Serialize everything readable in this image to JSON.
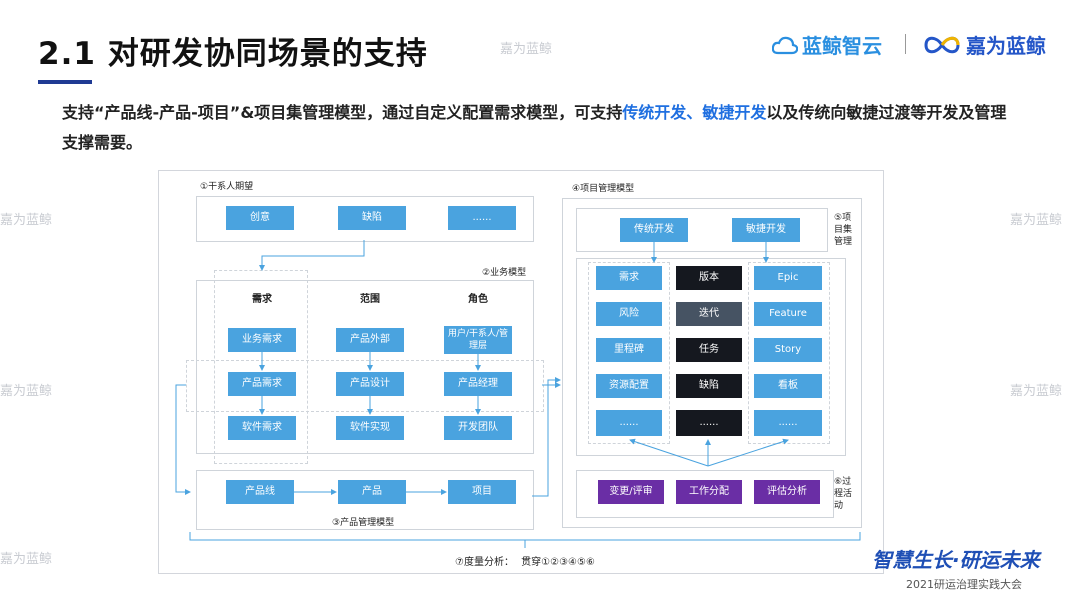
{
  "header": {
    "title": "2.1 对研发协同场景的支持",
    "logo1": "蓝鲸智云",
    "logo2": "嘉为蓝鲸",
    "watermark": "嘉为蓝鲸"
  },
  "subtitle": {
    "part1": "支持“产品线-产品-项目”&项目集管理模型，通过自定义配置需求模型，可支持",
    "hl1": "传统开发",
    "sep": "、",
    "hl2": "敏捷开发",
    "part2": "以及传统向敏捷过渡等开发及管理支撑需要。"
  },
  "diagram": {
    "stakeholder": {
      "label": "①干系人期望",
      "items": [
        "创意",
        "缺陷",
        "......"
      ]
    },
    "business": {
      "label": "②业务模型",
      "columns": [
        {
          "header": "需求",
          "items": [
            "业务需求",
            "产品需求",
            "软件需求"
          ]
        },
        {
          "header": "范围",
          "items": [
            "产品外部",
            "产品设计",
            "软件实现"
          ]
        },
        {
          "header": "角色",
          "items": [
            "用户/干系人/管理层",
            "产品经理",
            "开发团队"
          ]
        }
      ]
    },
    "product": {
      "label": "③产品管理模型",
      "items": [
        "产品线",
        "产品",
        "项目"
      ]
    },
    "project": {
      "label": "④项目管理模型",
      "modes": [
        "传统开发",
        "敏捷开发"
      ],
      "traditional": [
        "需求",
        "风险",
        "里程碑",
        "资源配置",
        "......"
      ],
      "shared": [
        "版本",
        "迭代",
        "任务",
        "缺陷",
        "......"
      ],
      "agile": [
        "Epic",
        "Feature",
        "Story",
        "看板",
        "......"
      ],
      "program_label": "⑤项目集管理",
      "process_label": "⑥过程活动",
      "process": [
        "变更/评审",
        "工作分配",
        "评估分析"
      ]
    },
    "metrics": {
      "label": "⑦度量分析：",
      "value": "贯穿①②③④⑤⑥"
    }
  },
  "footer": {
    "slogan": "智慧生长·研运未来",
    "conference": "2021研运治理实践大会"
  },
  "colors": {
    "accent_blue": "#4aa3df",
    "dark": "#15181f",
    "slate": "#465363",
    "purple": "#6a2ea5",
    "highlight": "#1f6fe0"
  }
}
